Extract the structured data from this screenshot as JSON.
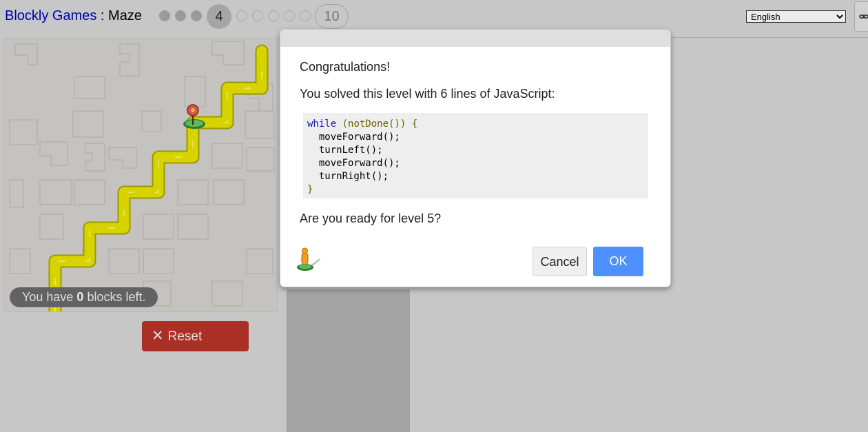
{
  "header": {
    "site_name": "Blockly Games",
    "separator": " : ",
    "game_name": "Maze",
    "current_level": "4",
    "last_level": "10",
    "language": "English"
  },
  "maze": {
    "blocks_left_prefix": "You have ",
    "blocks_left_count": "0",
    "blocks_left_suffix": " blocks left.",
    "reset_label": "Reset",
    "path_color": "#d6d300"
  },
  "dialog": {
    "congrats": "Congratulations!",
    "solved": "You solved this level with 6 lines of JavaScript:",
    "code": {
      "line1_kw": "while",
      "line1_rest": " (notDone()) {",
      "line2": "  moveForward();",
      "line3": "  turnLeft();",
      "line4": "  moveForward();",
      "line5": "  turnRight();",
      "line6": "}"
    },
    "next_prompt": "Are you ready for level 5?",
    "cancel_label": "Cancel",
    "ok_label": "OK"
  },
  "colors": {
    "link": "#0000ad",
    "ok_button": "#4d90fe",
    "reset_button": "#aa3026"
  },
  "icons": [
    "link-icon",
    "close-icon",
    "pegman-icon",
    "marker-icon"
  ]
}
